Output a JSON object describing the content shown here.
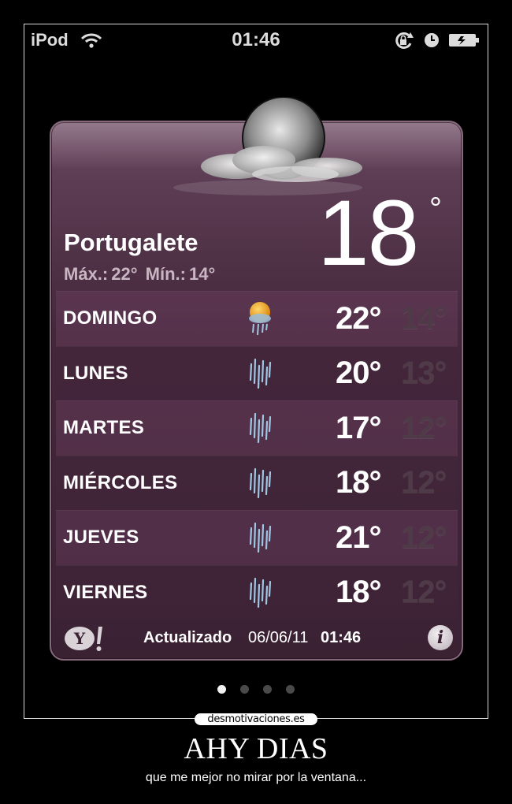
{
  "status_bar": {
    "carrier": "iPod",
    "time": "01:46",
    "icons": [
      "wifi-icon",
      "rotation-lock-icon",
      "alarm-icon",
      "battery-icon"
    ]
  },
  "weather": {
    "city": "Portugalete",
    "max_label": "Máx.:",
    "max_value": "22°",
    "min_label": "Mín.:",
    "min_value": "14°",
    "current_temp": "18",
    "current_unit": "°",
    "current_icon": "moon-cloud-icon",
    "forecast": [
      {
        "day": "DOMINGO",
        "icon": "sun-rain-icon",
        "high": "22°",
        "low": "14°"
      },
      {
        "day": "LUNES",
        "icon": "rain-icon",
        "high": "20°",
        "low": "13°"
      },
      {
        "day": "MARTES",
        "icon": "rain-icon",
        "high": "17°",
        "low": "12°"
      },
      {
        "day": "MIÉRCOLES",
        "icon": "rain-icon",
        "high": "18°",
        "low": "12°"
      },
      {
        "day": "JUEVES",
        "icon": "rain-icon",
        "high": "21°",
        "low": "12°"
      },
      {
        "day": "VIERNES",
        "icon": "rain-icon",
        "high": "18°",
        "low": "12°"
      }
    ],
    "footer": {
      "provider_icon": "yahoo-icon",
      "updated_label": "Actualizado",
      "updated_date": "06/06/11",
      "updated_time": "01:46",
      "info_label": "i"
    }
  },
  "pager": {
    "pages": 4,
    "active_index": 0
  },
  "caption": {
    "site": "desmotivaciones.es",
    "title": "AHY DIAS",
    "subtitle": "que me mejor no mirar por la ventana..."
  },
  "colors": {
    "widget_top": "#7c5b72",
    "widget_bottom": "#3a2233",
    "low_temp": "#4f3a48",
    "accent_sun": "#f2a51c"
  }
}
